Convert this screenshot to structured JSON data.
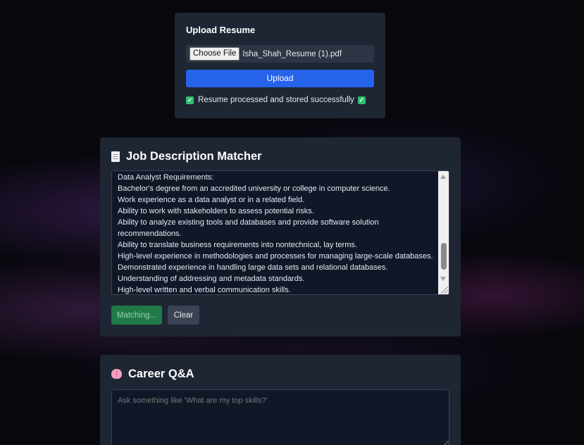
{
  "upload": {
    "title": "Upload Resume",
    "choose_file_label": "Choose File",
    "file_name": "Isha_Shah_Resume (1).pdf",
    "upload_button": "Upload",
    "status": "Resume processed and stored successfully"
  },
  "jd_matcher": {
    "icon": "document-icon",
    "title": "Job Description Matcher",
    "textarea_value": "Data Analyst Requirements:\nBachelor's degree from an accredited university or college in computer science.\nWork experience as a data analyst or in a related field.\nAbility to work with stakeholders to assess potential risks.\nAbility to analyze existing tools and databases and provide software solution recommendations.\nAbility to translate business requirements into nontechnical, lay terms.\nHigh-level experience in methodologies and processes for managing large-scale databases.\nDemonstrated experience in handling large data sets and relational databases.\nUnderstanding of addressing and metadata standards.\nHigh-level written and verbal communication skills.",
    "match_button": "Matching...",
    "clear_button": "Clear"
  },
  "career_qa": {
    "icon": "brain-icon",
    "title": "Career Q&A",
    "placeholder": "Ask something like 'What are my top skills?'"
  },
  "colors": {
    "card_bg": "#1e2533",
    "primary": "#2563eb",
    "success": "#1f7a47"
  }
}
